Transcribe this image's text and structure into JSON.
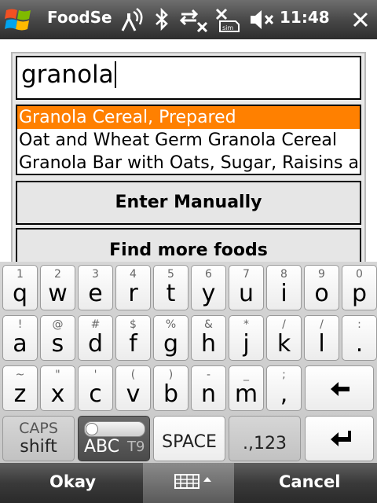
{
  "status_bar": {
    "title": "FoodSe",
    "time": "11:48",
    "icons": [
      "windows-start-icon",
      "antenna-icon",
      "bluetooth-icon",
      "data-connection-off-icon",
      "no-sim-icon",
      "volume-muted-icon"
    ]
  },
  "search": {
    "value": "granola"
  },
  "results": [
    {
      "label": "Granola Cereal, Prepared",
      "selected": true
    },
    {
      "label": "Oat and Wheat Germ Granola Cereal",
      "selected": false
    },
    {
      "label": "Granola Bar with Oats, Sugar, Raisins and",
      "selected": false
    }
  ],
  "buttons": {
    "enter_manually": "Enter Manually",
    "find_more": "Find more foods"
  },
  "keyboard": {
    "row1": [
      {
        "main": "q",
        "sup": "1"
      },
      {
        "main": "w",
        "sup": "2"
      },
      {
        "main": "e",
        "sup": "3"
      },
      {
        "main": "r",
        "sup": "4"
      },
      {
        "main": "t",
        "sup": "5"
      },
      {
        "main": "y",
        "sup": "6"
      },
      {
        "main": "u",
        "sup": "7"
      },
      {
        "main": "i",
        "sup": "8"
      },
      {
        "main": "o",
        "sup": "9"
      },
      {
        "main": "p",
        "sup": "0"
      }
    ],
    "row2": [
      {
        "main": "a",
        "sup": "!"
      },
      {
        "main": "s",
        "sup": "@"
      },
      {
        "main": "d",
        "sup": "#"
      },
      {
        "main": "f",
        "sup": "$"
      },
      {
        "main": "g",
        "sup": "%"
      },
      {
        "main": "h",
        "sup": "&"
      },
      {
        "main": "j",
        "sup": "*"
      },
      {
        "main": "k",
        "sup": "/"
      },
      {
        "main": "l",
        "sup": "/"
      },
      {
        "main": ".",
        "sup": ":"
      }
    ],
    "row3": [
      {
        "main": "z",
        "sup": "~"
      },
      {
        "main": "x",
        "sup": "\""
      },
      {
        "main": "c",
        "sup": "'"
      },
      {
        "main": "v",
        "sup": "("
      },
      {
        "main": "b",
        "sup": ")"
      },
      {
        "main": "n",
        "sup": "-"
      },
      {
        "main": "m",
        "sup": "_"
      },
      {
        "main": ",",
        "sup": ";"
      }
    ],
    "caps_label": "CAPS",
    "shift_label": "shift",
    "abc_label": "ABC",
    "t9_label": "T9",
    "space_label": "SPACE",
    "num_label": ".,123",
    "backspace_icon": "backspace-arrow-icon",
    "enter_icon": "enter-return-icon"
  },
  "softkeys": {
    "left": "Okay",
    "right": "Cancel",
    "middle_icon": "keyboard-icon"
  }
}
